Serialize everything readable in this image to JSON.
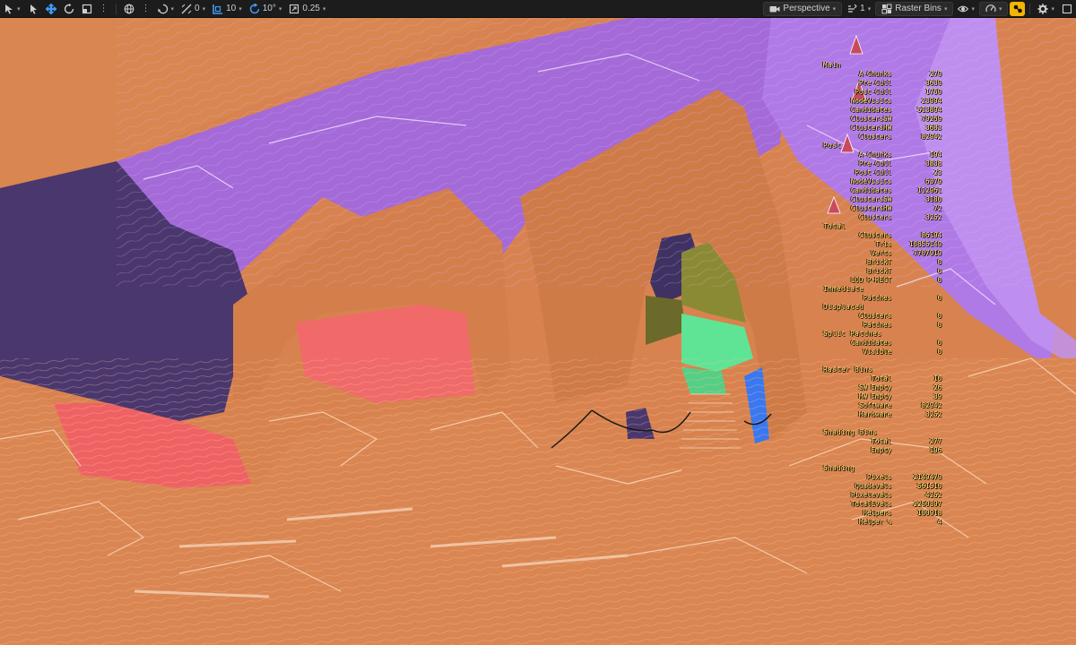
{
  "toolbar": {
    "snap_angle": "0",
    "grid_size": "10",
    "rotation_snap": "10°",
    "scale_snap": "0.25",
    "view_mode": "Perspective",
    "camera_speed": "1",
    "view_label": "Raster Bins"
  },
  "colors": {
    "toolbar_bg": "#1c1c1c",
    "accent_blue": "#3e9cf5",
    "warning": "#f5b400",
    "stats_text": "#ffe46b",
    "rock_orange": "#d8834f",
    "bin_purple": "#a76ae0",
    "bin_dark": "#463668",
    "bin_red": "#f06a6a",
    "bin_green": "#5fe495",
    "bin_olive": "#6c6a2a",
    "bin_blue": "#3a78f0"
  },
  "stats": {
    "main_title": "Main",
    "main": [
      {
        "k": "A-Chunks",
        "v": "279"
      },
      {
        "k": "Pre-Cull",
        "v": "3639"
      },
      {
        "k": "Post-Cull",
        "v": "1759"
      },
      {
        "k": "NodeVisits",
        "v": "23994"
      },
      {
        "k": "Candidates",
        "v": "513894"
      },
      {
        "k": "ClustersSW",
        "v": "79269"
      },
      {
        "k": "ClustersHW",
        "v": "3683"
      },
      {
        "k": "Clusters",
        "v": "82942"
      }
    ],
    "post_title": "Post",
    "post": [
      {
        "k": "A-Chunks",
        "v": "194"
      },
      {
        "k": "Pre-Cull",
        "v": "3838"
      },
      {
        "k": "Post-Cull",
        "v": "23"
      },
      {
        "k": "NodeVisits",
        "v": "6379"
      },
      {
        "k": "Candidates",
        "v": "112961"
      },
      {
        "k": "ClustersSW",
        "v": "3180"
      },
      {
        "k": "ClustersHW",
        "v": "72"
      },
      {
        "k": "Clusters",
        "v": "3252"
      }
    ],
    "total_title": "Total",
    "total": [
      {
        "k": "Clusters",
        "v": "86194"
      },
      {
        "k": "Tris",
        "v": "10855149"
      },
      {
        "k": "Verts",
        "v": "7707919"
      },
      {
        "k": "BrickT",
        "v": "0"
      },
      {
        "k": "BrickT",
        "v": "0"
      },
      {
        "k": "LOD P-RECT",
        "v": "0"
      }
    ],
    "imm_title": "Immediate",
    "imm": [
      {
        "k": "Patches",
        "v": "0"
      }
    ],
    "disp_title": "Displaced",
    "disp": [
      {
        "k": "Clusters",
        "v": "0"
      },
      {
        "k": "Patches",
        "v": "0"
      }
    ],
    "split_title": "Split Patches",
    "split": [
      {
        "k": "Candidates",
        "v": "0"
      },
      {
        "k": "Visible",
        "v": "0"
      }
    ],
    "raster_title": "Raster Bins",
    "raster": [
      {
        "k": "Total",
        "v": "10"
      },
      {
        "k": "SW Empty",
        "v": "26"
      },
      {
        "k": "HW Empty",
        "v": "39"
      },
      {
        "k": "Software",
        "v": "82942"
      },
      {
        "k": "Hardware",
        "v": "3252"
      }
    ],
    "shading_bins_title": "Shading Bins",
    "shading_bins": [
      {
        "k": "Total",
        "v": "277"
      },
      {
        "k": "Empty",
        "v": "196"
      }
    ],
    "shading_title": "Shading",
    "shading": [
      {
        "k": "Pixels",
        "v": "2149479"
      },
      {
        "k": "Quadevals",
        "v": "561510"
      },
      {
        "k": "Pixelevals",
        "v": "4252"
      },
      {
        "k": "TotalEvals",
        "v": "2250397"
      },
      {
        "k": "Helpers",
        "v": "100918"
      },
      {
        "k": "Helper %",
        "v": "4"
      }
    ]
  }
}
